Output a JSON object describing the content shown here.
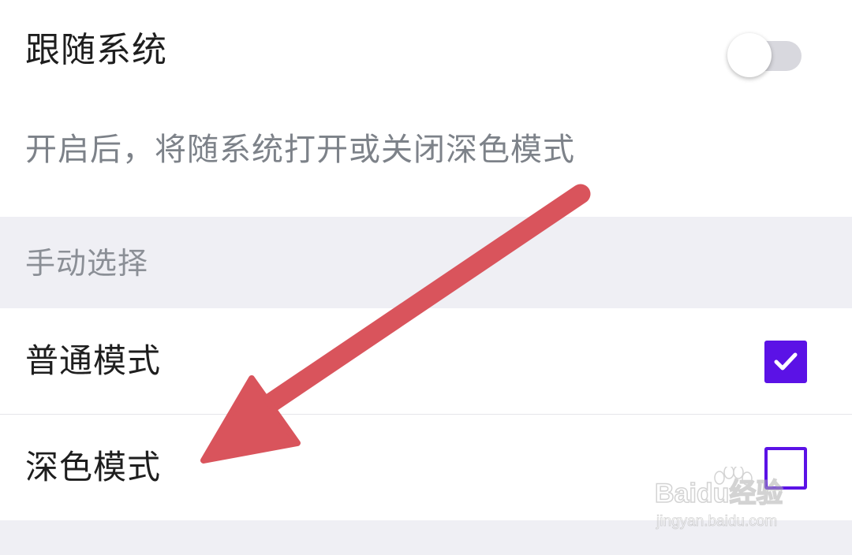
{
  "follow_system": {
    "label": "跟随系统",
    "toggle_on": false,
    "description": "开启后，将随系统打开或关闭深色模式"
  },
  "manual_section": {
    "title": "手动选择"
  },
  "options": [
    {
      "label": "普通模式",
      "checked": true
    },
    {
      "label": "深色模式",
      "checked": false
    }
  ],
  "colors": {
    "accent": "#5b12e6",
    "section_bg": "#efeff4",
    "annotation_arrow": "#d9545c"
  },
  "watermark": {
    "brand": "Baidu经验",
    "url": "jingyan.baidu.com"
  }
}
